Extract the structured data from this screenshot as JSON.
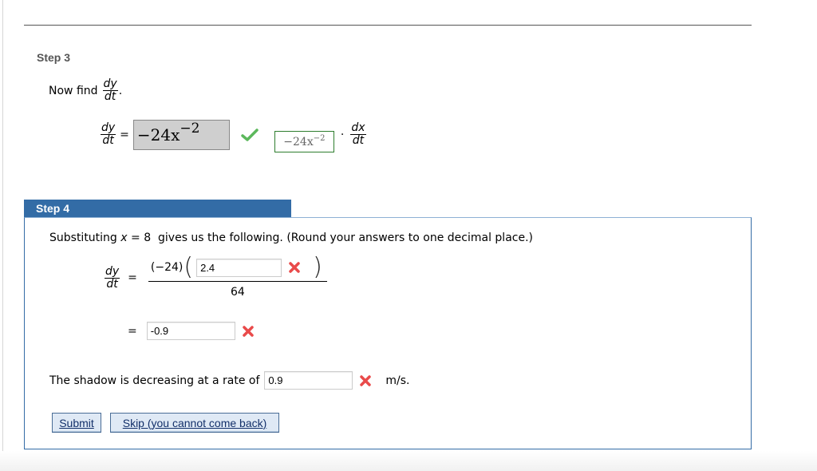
{
  "step3": {
    "title": "Step 3",
    "prompt": "Now find",
    "prompt_end": ".",
    "dydt_num": "dy",
    "dydt_den": "dt",
    "equals": "=",
    "answer": {
      "base": "−24x",
      "exp": "−2",
      "status": "correct"
    },
    "preview": {
      "base": "−24x",
      "exp": "−2"
    },
    "dot": "·",
    "dxdt_num": "dx",
    "dxdt_den": "dt"
  },
  "step4": {
    "title": "Step 4",
    "intro_pre": "Substituting ",
    "intro_var": "x",
    "intro_eq": " = 8  gives us the following. (Round your answers to one decimal place.)",
    "dydt_num": "dy",
    "dydt_den": "dt",
    "equals": "=",
    "coef": "(−24)",
    "open_paren": "(",
    "close_paren": ")",
    "input1": {
      "value": "2.4",
      "status": "incorrect"
    },
    "denominator": "64",
    "input2": {
      "value": "-0.9",
      "status": "incorrect"
    },
    "rate_text": "The shadow is decreasing at a rate of",
    "input3": {
      "value": "0.9",
      "status": "incorrect"
    },
    "units": "m/s.",
    "buttons": {
      "submit": "Submit",
      "skip": "Skip (you cannot come back)"
    }
  },
  "colors": {
    "accent": "#336ca6",
    "correct": "#4caf50",
    "incorrect": "#e94a4a"
  }
}
